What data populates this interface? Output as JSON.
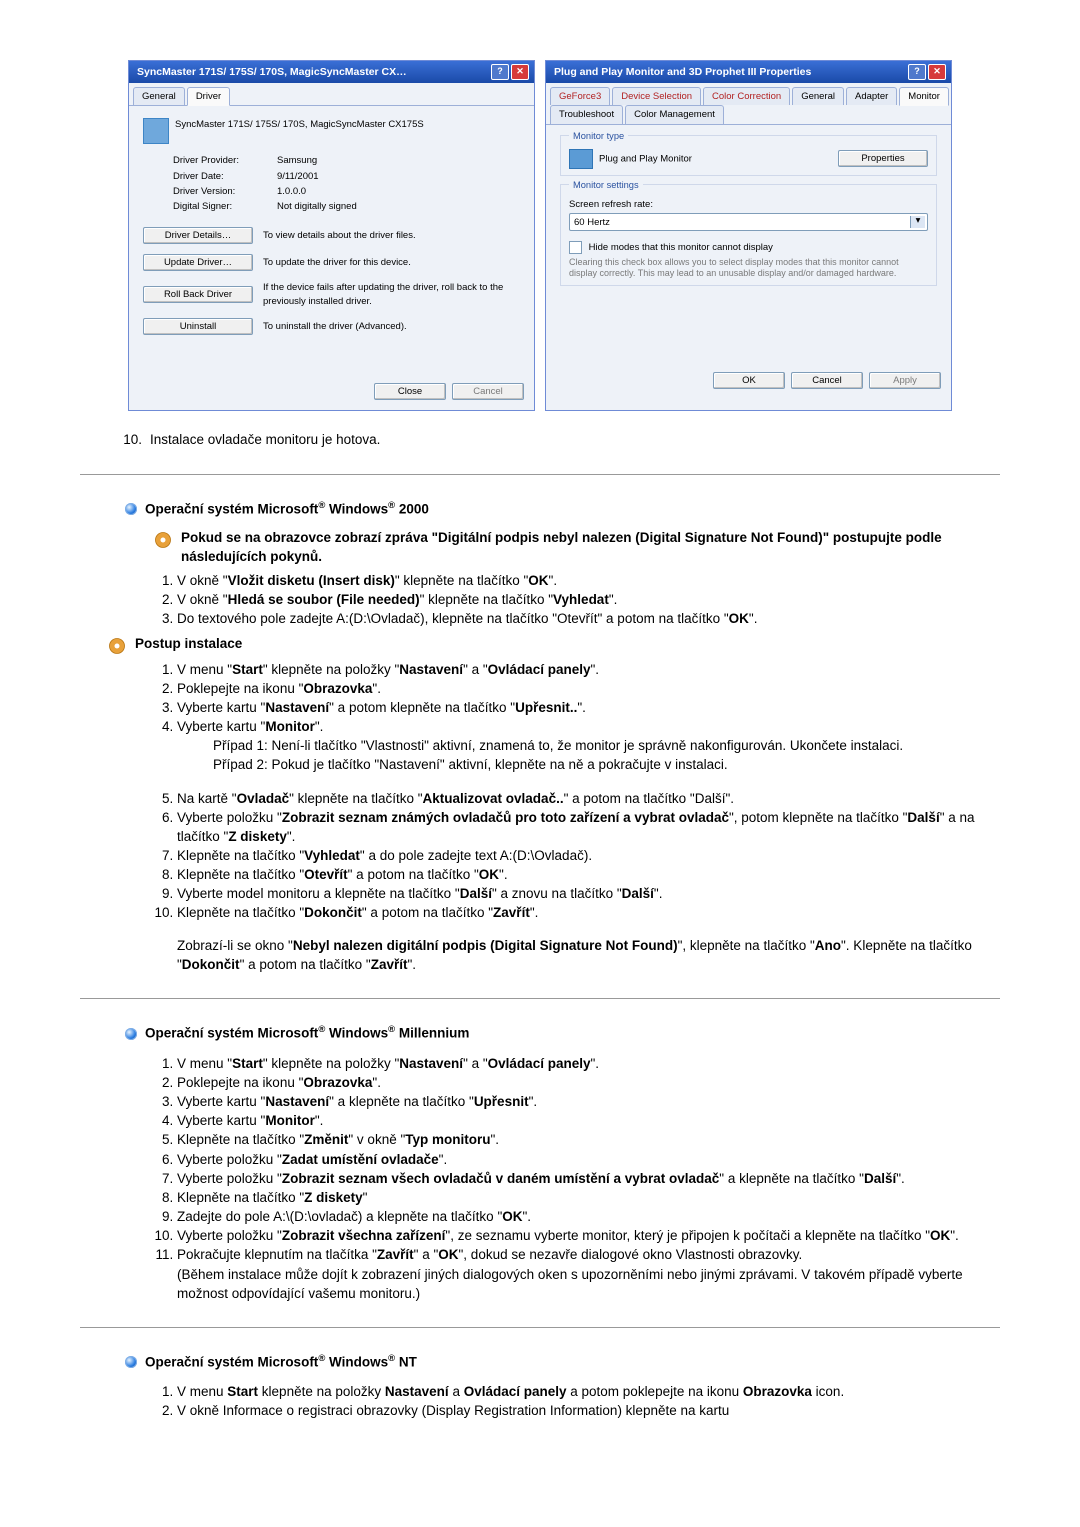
{
  "dialog1": {
    "title": "SyncMaster 171S/ 175S/ 170S, MagicSyncMaster CX…",
    "tab_general": "General",
    "tab_driver": "Driver",
    "model": "SyncMaster 171S/ 175S/ 170S, MagicSyncMaster CX175S",
    "provider_label": "Driver Provider:",
    "provider": "Samsung",
    "date_label": "Driver Date:",
    "date": "9/11/2001",
    "version_label": "Driver Version:",
    "version": "1.0.0.0",
    "signer_label": "Digital Signer:",
    "signer": "Not digitally signed",
    "btn_details": "Driver Details…",
    "desc_details": "To view details about the driver files.",
    "btn_update": "Update Driver…",
    "desc_update": "To update the driver for this device.",
    "btn_rollback": "Roll Back Driver",
    "desc_rollback": "If the device fails after updating the driver, roll back to the previously installed driver.",
    "btn_uninstall": "Uninstall",
    "desc_uninstall": "To uninstall the driver (Advanced).",
    "close": "Close",
    "cancel": "Cancel"
  },
  "dialog2": {
    "title": "Plug and Play Monitor and 3D Prophet III Properties",
    "tabs": [
      "GeForce3",
      "Device Selection",
      "Color Correction",
      "General",
      "Adapter",
      "Monitor",
      "Troubleshoot",
      "Color Management"
    ],
    "grp_monitor_type": "Monitor type",
    "monitor_type": "Plug and Play Monitor",
    "btn_props": "Properties",
    "grp_monitor_settings": "Monitor settings",
    "refresh_label": "Screen refresh rate:",
    "refresh_value": "60 Hertz",
    "hide_check": "Hide modes that this monitor cannot display",
    "hide_desc": "Clearing this check box allows you to select display modes that this monitor cannot display correctly. This may lead to an unusable display and/or damaged hardware.",
    "ok": "OK",
    "cancel": "Cancel",
    "apply": "Apply"
  },
  "line10": "Instalace ovladače monitoru je hotova.",
  "win2000": {
    "heading_pre": "Operační systém Microsoft",
    "heading_post": " Windows",
    "heading_ver": " 2000",
    "digsig_intro": "Pokud se na obrazovce zobrazí zpráva \"Digitální podpis nebyl nalezen (Digital Signature Not Found)\" postupujte podle následujících pokynů.",
    "s1": {
      "pre": "V okně \"",
      "b": "Vložit disketu (Insert disk)",
      "mid": "\" klepněte na tlačítko \"",
      "b2": "OK",
      "post": "\"."
    },
    "s2": {
      "pre": "V okně \"",
      "b": "Hledá se soubor (File needed)",
      "mid": "\" klepněte na tlačítko \"",
      "b2": "Vyhledat",
      "post": "\"."
    },
    "s3": {
      "pre": "Do textového pole zadejte A:(D:\\Ovladač), klepněte na tlačítko \"Otevřít\" a potom na tlačítko \"",
      "b": "OK",
      "post": "\"."
    },
    "postup": "Postup instalace",
    "p1": {
      "pre": "V menu \"",
      "b": "Start",
      "mid": "\" klepněte na položky \"",
      "b2": "Nastavení",
      "mid2": "\" a \"",
      "b3": "Ovládací panely",
      "post": "\"."
    },
    "p2": {
      "pre": "Poklepejte na ikonu \"",
      "b": "Obrazovka",
      "post": "\"."
    },
    "p3": {
      "pre": "Vyberte kartu \"",
      "b": "Nastavení",
      "mid": "\" a potom klepněte na tlačítko \"",
      "b2": "Upřesnit..",
      "post": "\"."
    },
    "p4": {
      "pre": "Vyberte kartu \"",
      "b": "Monitor",
      "post": "\"."
    },
    "p4c1": "Případ 1: Není-li tlačítko \"Vlastnosti\" aktivní, znamená to, že monitor je správně nakonfigurován. Ukončete instalaci.",
    "p4c2": "Případ 2: Pokud je tlačítko \"Nastavení\" aktivní, klepněte na ně a pokračujte v instalaci.",
    "p5": {
      "pre": "Na kartě \"",
      "b": "Ovladač",
      "mid": "\" klepněte na tlačítko \"",
      "b2": "Aktualizovat ovladač..",
      "post": "\" a potom na tlačítko \"Další\"."
    },
    "p6": {
      "pre": "Vyberte položku \"",
      "b": "Zobrazit seznam známých ovladačů pro toto zařízení a vybrat ovladač",
      "mid": "\", potom klepněte na tlačítko \"",
      "b2": "Další",
      "mid2": "\" a na tlačítko \"",
      "b3": "Z diskety",
      "post": "\"."
    },
    "p7": {
      "pre": "Klepněte na tlačítko \"",
      "b": "Vyhledat",
      "post": "\" a do pole zadejte text A:(D:\\Ovladač)."
    },
    "p8": {
      "pre": "Klepněte na tlačítko \"",
      "b": "Otevřít",
      "mid": "\" a potom na tlačítko \"",
      "b2": "OK",
      "post": "\"."
    },
    "p9": {
      "pre": "Vyberte model monitoru a klepněte na tlačítko \"",
      "b": "Další",
      "mid": "\" a znovu na tlačítko \"",
      "b2": "Další",
      "post": "\"."
    },
    "p10": {
      "pre": "Klepněte na tlačítko \"",
      "b": "Dokončit",
      "mid": "\" a potom na tlačítko \"",
      "b2": "Zavřít",
      "post": "\"."
    },
    "note": {
      "pre": "Zobrazí-li se okno \"",
      "b": "Nebyl nalezen digitální podpis (Digital Signature Not Found)",
      "mid": "\", klepněte na tlačítko \"",
      "b2": "Ano",
      "mid2": "\". Klepněte na tlačítko \"",
      "b3": "Dokončit",
      "mid3": "\" a potom na tlačítko \"",
      "b4": "Zavřít",
      "post": "\"."
    }
  },
  "winme": {
    "heading_pre": "Operační systém Microsoft",
    "heading_post": " Windows",
    "heading_ver": " Millennium",
    "m1": {
      "pre": "V menu \"",
      "b": "Start",
      "mid": "\" klepněte na položky \"",
      "b2": "Nastavení",
      "mid2": "\" a \"",
      "b3": "Ovládací panely",
      "post": "\"."
    },
    "m2": {
      "pre": "Poklepejte na ikonu \"",
      "b": "Obrazovka",
      "post": "\"."
    },
    "m3": {
      "pre": "Vyberte kartu \"",
      "b": "Nastavení",
      "mid": "\" a klepněte na tlačítko \"",
      "b2": "Upřesnit",
      "post": "\"."
    },
    "m4": {
      "pre": "Vyberte kartu \"",
      "b": "Monitor",
      "post": "\"."
    },
    "m5": {
      "pre": "Klepněte na tlačítko \"",
      "b": "Změnit",
      "mid": "\" v okně \"",
      "b2": "Typ monitoru",
      "post": "\"."
    },
    "m6": {
      "pre": "Vyberte položku \"",
      "b": "Zadat umístění ovladače",
      "post": "\"."
    },
    "m7": {
      "pre": "Vyberte položku \"",
      "b": "Zobrazit seznam všech ovladačů v daném umístění a vybrat ovladač",
      "mid": "\" a klepněte na tlačítko \"",
      "b2": "Další",
      "post": "\"."
    },
    "m8": {
      "pre": "Klepněte na tlačítko \"",
      "b": "Z diskety",
      "post": "\""
    },
    "m9": {
      "pre": "Zadejte do pole A:\\(D:\\ovladač) a klepněte na tlačítko \"",
      "b": "OK",
      "post": "\"."
    },
    "m10": {
      "pre": "Vyberte položku \"",
      "b": "Zobrazit všechna zařízení",
      "mid": "\", ze seznamu vyberte monitor, který je připojen k počítači a klepněte na tlačítko \"",
      "b2": "OK",
      "post": "\"."
    },
    "m11": {
      "pre": "Pokračujte klepnutím na tlačítka \"",
      "b": "Zavřít",
      "mid": "\" a \"",
      "b2": "OK",
      "post": "\", dokud se nezavře dialogové okno Vlastnosti obrazovky."
    },
    "m11b": "(Během instalace může dojít k zobrazení jiných dialogových oken s upozorněními nebo jinými zprávami. V takovém případě vyberte možnost odpovídající vašemu monitoru.)"
  },
  "winnt": {
    "heading_pre": "Operační systém Microsoft",
    "heading_post": " Windows",
    "heading_ver": " NT",
    "n1": {
      "pre": "V menu ",
      "b": "Start",
      "mid": " klepněte na položky ",
      "b2": "Nastavení",
      "mid2": " a ",
      "b3": "Ovládací panely",
      "mid3": " a potom poklepejte na ikonu ",
      "b4": "Obrazovka",
      "post": " icon."
    },
    "n2": "V okně Informace o registraci obrazovky (Display Registration Information) klepněte na kartu"
  }
}
